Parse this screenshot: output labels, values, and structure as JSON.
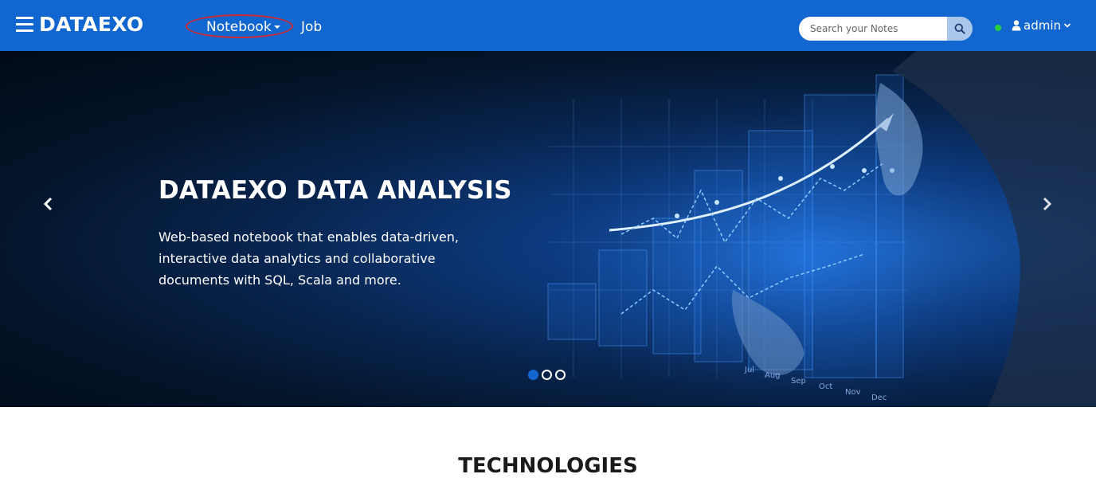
{
  "brand": "DATAEXO",
  "nav": {
    "notebook_label": "Notebook",
    "job_label": "Job"
  },
  "search": {
    "placeholder": "Search your Notes"
  },
  "user": {
    "name": "admin",
    "status_color": "#27d13a"
  },
  "hero": {
    "title": "DATAEXO DATA ANALYSIS",
    "description": "Web-based notebook that enables data-driven, interactive data analytics and collaborative documents with SQL, Scala and more.",
    "slide_indicators": 3,
    "active_slide": 1,
    "chart_month_labels": [
      "Jul",
      "Aug",
      "Sep",
      "Oct",
      "Nov",
      "Dec"
    ]
  },
  "section": {
    "title": "TECHNOLOGIES"
  },
  "colors": {
    "navbar": "#1266d0",
    "accent": "#1266d0",
    "annotation": "#cf2b33"
  },
  "icons": {
    "menu": "hamburger-icon",
    "search": "search-icon",
    "user": "user-icon",
    "prev": "chevron-left-icon",
    "next": "chevron-right-icon"
  }
}
